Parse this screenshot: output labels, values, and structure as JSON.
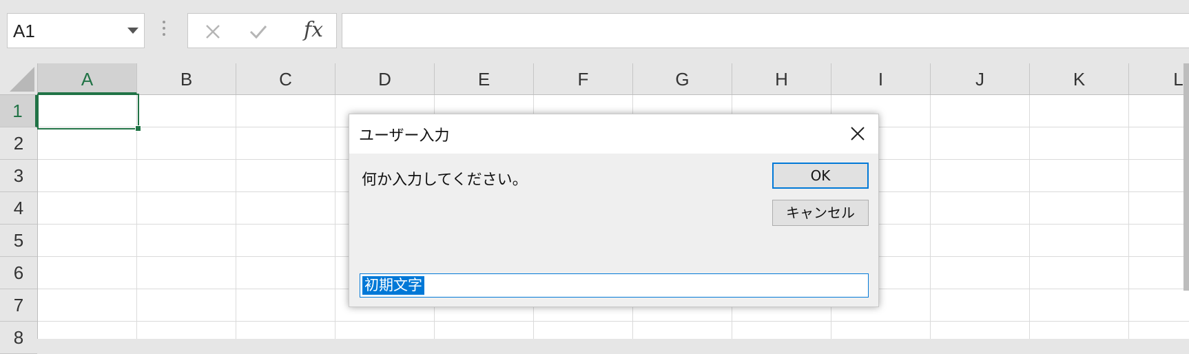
{
  "name_box": {
    "value": "A1"
  },
  "formula_bar": {
    "fx_label": "fx",
    "value": ""
  },
  "columns": [
    "A",
    "B",
    "C",
    "D",
    "E",
    "F",
    "G",
    "H",
    "I",
    "J",
    "K",
    "L"
  ],
  "rows": [
    "1",
    "2",
    "3",
    "4",
    "5",
    "6",
    "7",
    "8"
  ],
  "active_cell": {
    "column": "A",
    "row": "1"
  },
  "colors": {
    "accent": "#217346",
    "dialog_accent": "#0078d7"
  },
  "dialog": {
    "title": "ユーザー入力",
    "prompt": "何か入力してください。",
    "ok_label": "OK",
    "cancel_label": "キャンセル",
    "input_value": "初期文字",
    "close_icon": "close-icon"
  }
}
